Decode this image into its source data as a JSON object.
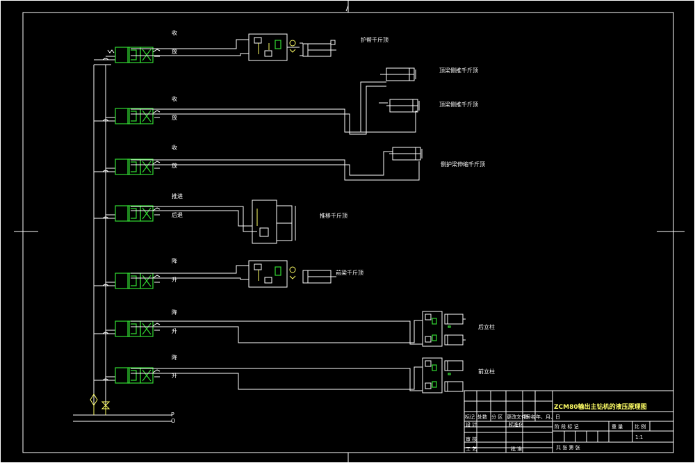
{
  "drawing": {
    "title": "ZCM80输出主钻机的液压原理图",
    "scale": "1:1"
  },
  "circuits": [
    {
      "top": "收",
      "bottom": "放"
    },
    {
      "top": "收",
      "bottom": "放"
    },
    {
      "top": "收",
      "bottom": "放"
    },
    {
      "top": "推进",
      "bottom": "后退"
    },
    {
      "top": "降",
      "bottom": "升"
    },
    {
      "top": "降",
      "bottom": "升"
    },
    {
      "top": "降",
      "bottom": "升"
    }
  ],
  "actuators": [
    "护帮千斤顶",
    "顶梁侧推千斤顶",
    "顶梁侧推千斤顶",
    "侧护梁伸缩千斤顶",
    "推移千斤顶",
    "前梁千斤顶",
    "后立柱",
    "前立柱"
  ],
  "supply": {
    "p": "P",
    "o": "O"
  },
  "title_block": {
    "h1": "标记",
    "h2": "处数",
    "h3": "分 区",
    "h4": "更改文件号",
    "h5": "签 名",
    "h6": "年、月、日",
    "r1": "设 计",
    "r1b": "标准化",
    "stage": "阶 段 标 记",
    "weight": "重 量",
    "scale_label": "比 例",
    "r3": "审 核",
    "r4": "工 艺",
    "r4b": "批 准",
    "sheets": "共   张  第   张"
  }
}
